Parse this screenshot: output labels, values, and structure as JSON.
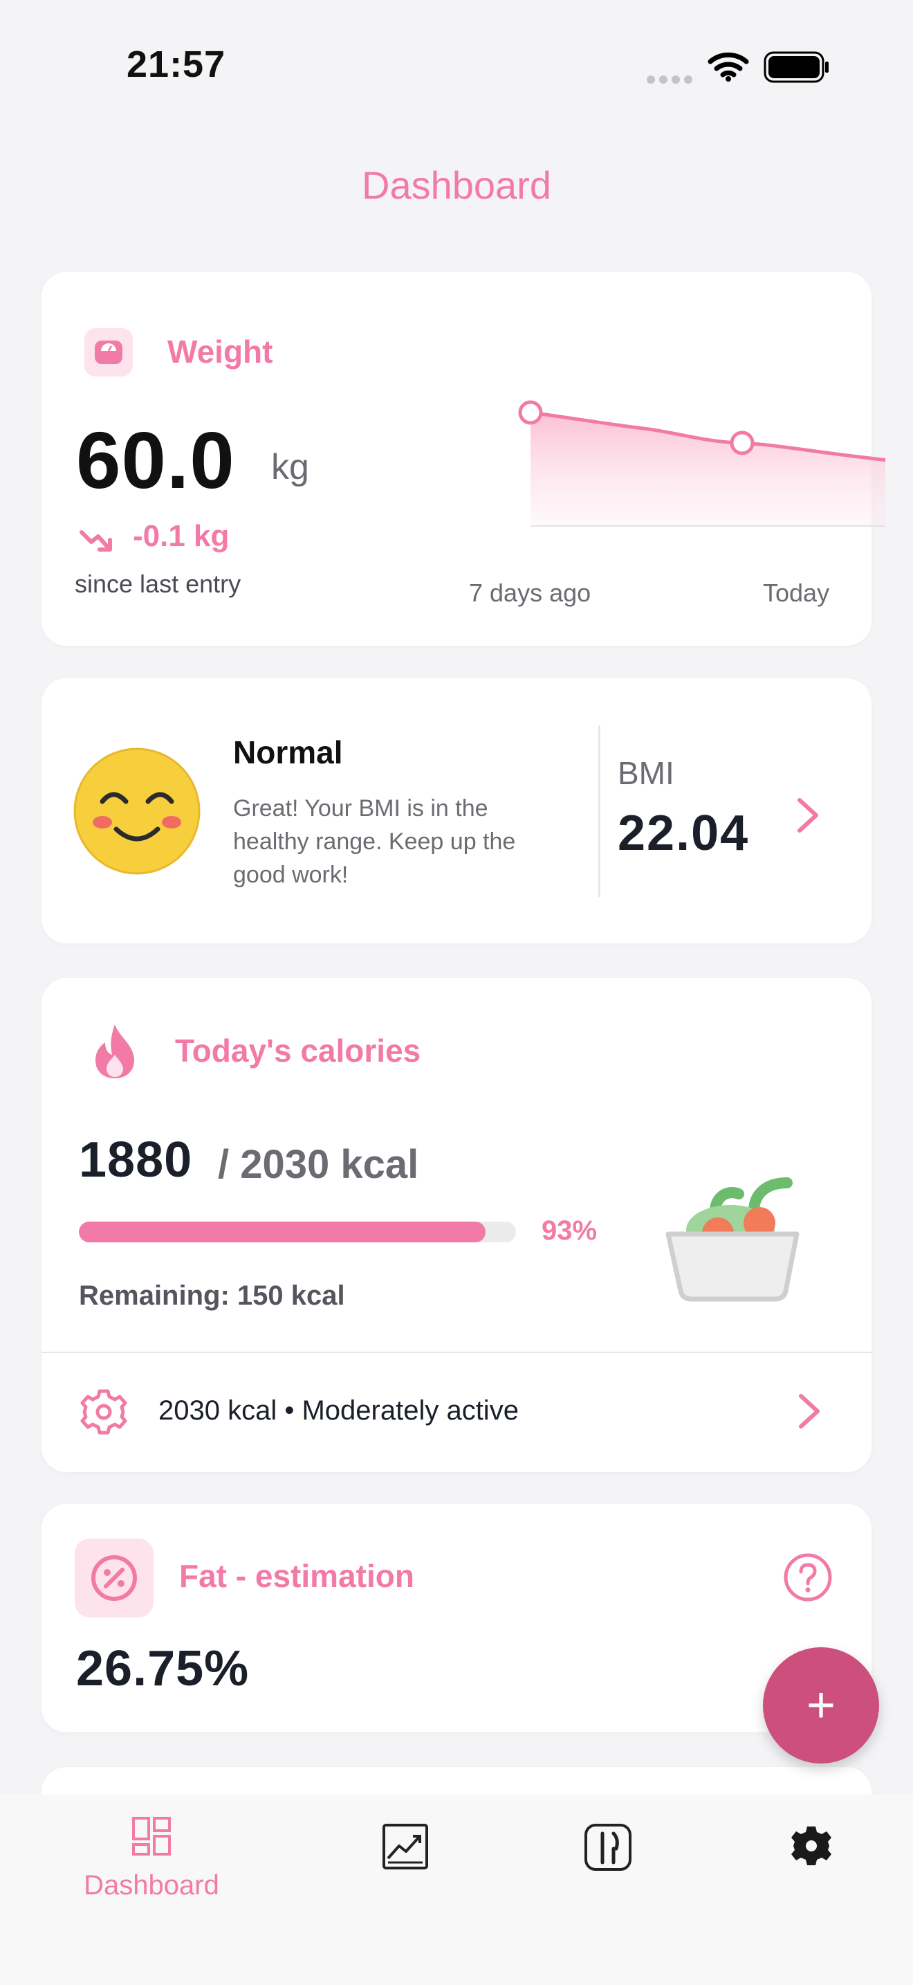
{
  "status_bar": {
    "time": "21:57"
  },
  "header": {
    "title": "Dashboard"
  },
  "weight_card": {
    "title": "Weight",
    "value": "60.0",
    "unit": "kg",
    "change": "-0.1 kg",
    "since_text": "since last entry",
    "chart_start_label": "7 days ago",
    "chart_end_label": "Today"
  },
  "bmi_card": {
    "status": "Normal",
    "description": "Great! Your BMI is in the healthy range. Keep up the good work!",
    "label": "BMI",
    "value": "22.04"
  },
  "calories_card": {
    "title": "Today's calories",
    "consumed": "1880",
    "goal_text": "/ 2030 kcal",
    "progress_fraction": 0.93,
    "progress_label": "93%",
    "remaining_text": "Remaining: 150 kcal",
    "settings_text": "2030 kcal • Moderately active"
  },
  "fat_card": {
    "title": "Fat - estimation",
    "value": "26.75%"
  },
  "fab": {
    "label": "+"
  },
  "tab_bar": {
    "tabs": [
      {
        "label": "Dashboard",
        "icon": "dashboard-icon",
        "active": true
      },
      {
        "label": "",
        "icon": "chart-icon",
        "active": false
      },
      {
        "label": "",
        "icon": "cutlery-icon",
        "active": false
      },
      {
        "label": "",
        "icon": "gear-icon",
        "active": false
      }
    ]
  },
  "colors": {
    "accent": "#f27aa6",
    "fab": "#cd4f7c",
    "text": "#1b1f2a"
  }
}
